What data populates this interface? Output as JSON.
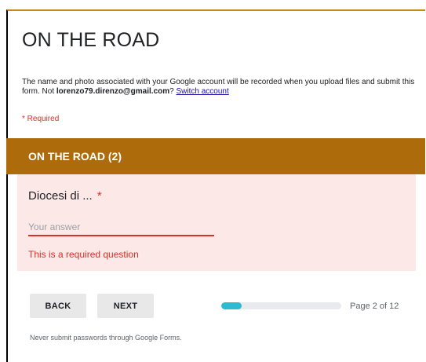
{
  "form": {
    "title": "ON THE ROAD",
    "notice_before": "The name and photo associated with your Google account will be recorded when you upload files and submit this form. Not ",
    "account_email": "lorenzo79.direnzo@gmail.com",
    "notice_after": "? ",
    "switch_account_label": "Switch account",
    "required_note": "* Required"
  },
  "section": {
    "title": "ON THE ROAD (2)",
    "color": "#ad6b0c"
  },
  "question": {
    "label": "Diocesi di ...",
    "required_marker": "*",
    "answer_value": "",
    "answer_placeholder": "Your answer",
    "error_message": "This is a required question"
  },
  "navigation": {
    "back_label": "BACK",
    "next_label": "NEXT"
  },
  "progress": {
    "current_page": 2,
    "total_pages": 12,
    "page_label": "Page 2 of 12",
    "fraction": 0.1667,
    "fill_color": "#2bbccf"
  },
  "footer": {
    "password_warning": "Never submit passwords through Google Forms."
  },
  "colors": {
    "error": "#d93025",
    "question_background": "#fce8e6",
    "link": "#1a0dab"
  }
}
